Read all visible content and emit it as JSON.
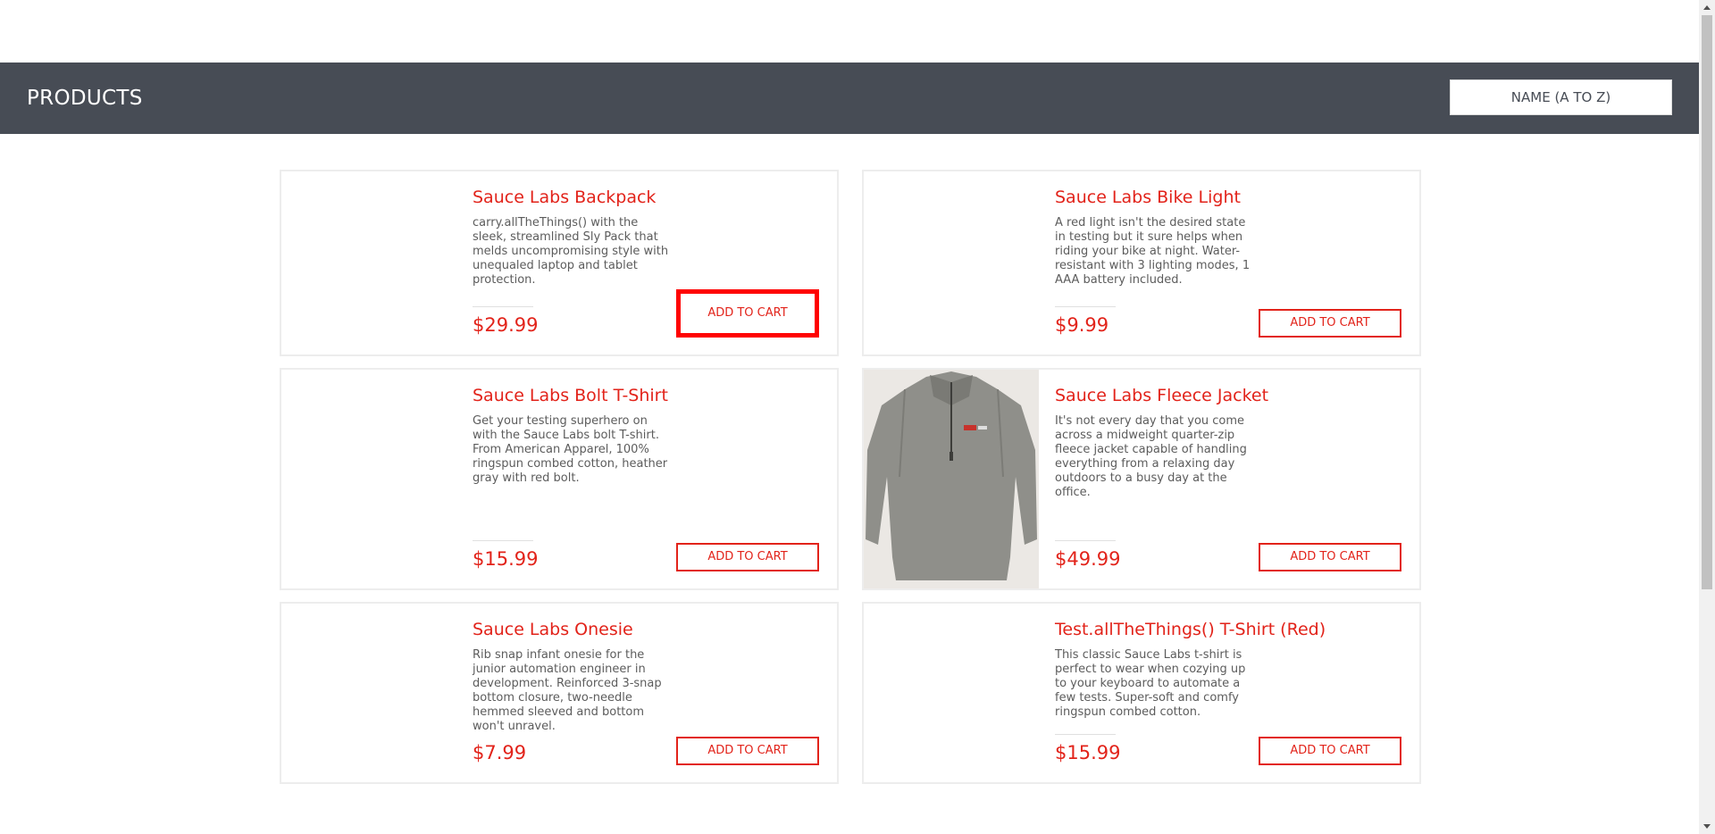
{
  "header": {
    "title": "PRODUCTS",
    "sort_label": "NAME (A TO Z)"
  },
  "products": [
    {
      "name": "Sauce Labs Backpack",
      "description": "carry.allTheThings() with the sleek, streamlined Sly Pack that melds uncompromising style with unequaled laptop and tablet protection.",
      "price": "$29.99",
      "button": "ADD TO CART"
    },
    {
      "name": "Sauce Labs Bike Light",
      "description": "A red light isn't the desired state in testing but it sure helps when riding your bike at night. Water-resistant with 3 lighting modes, 1 AAA battery included.",
      "price": "$9.99",
      "button": "ADD TO CART"
    },
    {
      "name": "Sauce Labs Bolt T-Shirt",
      "description": "Get your testing superhero on with the Sauce Labs bolt T-shirt. From American Apparel, 100% ringspun combed cotton, heather gray with red bolt.",
      "price": "$15.99",
      "button": "ADD TO CART"
    },
    {
      "name": "Sauce Labs Fleece Jacket",
      "description": "It's not every day that you come across a midweight quarter-zip fleece jacket capable of handling everything from a relaxing day outdoors to a busy day at the office.",
      "price": "$49.99",
      "button": "ADD TO CART"
    },
    {
      "name": "Sauce Labs Onesie",
      "description": "Rib snap infant onesie for the junior automation engineer in development. Reinforced 3-snap bottom closure, two-needle hemmed sleeved and bottom won't unravel.",
      "price": "$7.99",
      "button": "ADD TO CART"
    },
    {
      "name": "Test.allTheThings() T-Shirt (Red)",
      "description": "This classic Sauce Labs t-shirt is perfect to wear when cozying up to your keyboard to automate a few tests. Super-soft and comfy ringspun combed cotton.",
      "price": "$15.99",
      "button": "ADD TO CART"
    }
  ],
  "colors": {
    "accent": "#e2231a",
    "subheader": "#474c55",
    "highlight_border": "#ff0000"
  },
  "icons": {
    "scroll_up": "triangle-up-icon",
    "scroll_down": "triangle-down-icon"
  }
}
